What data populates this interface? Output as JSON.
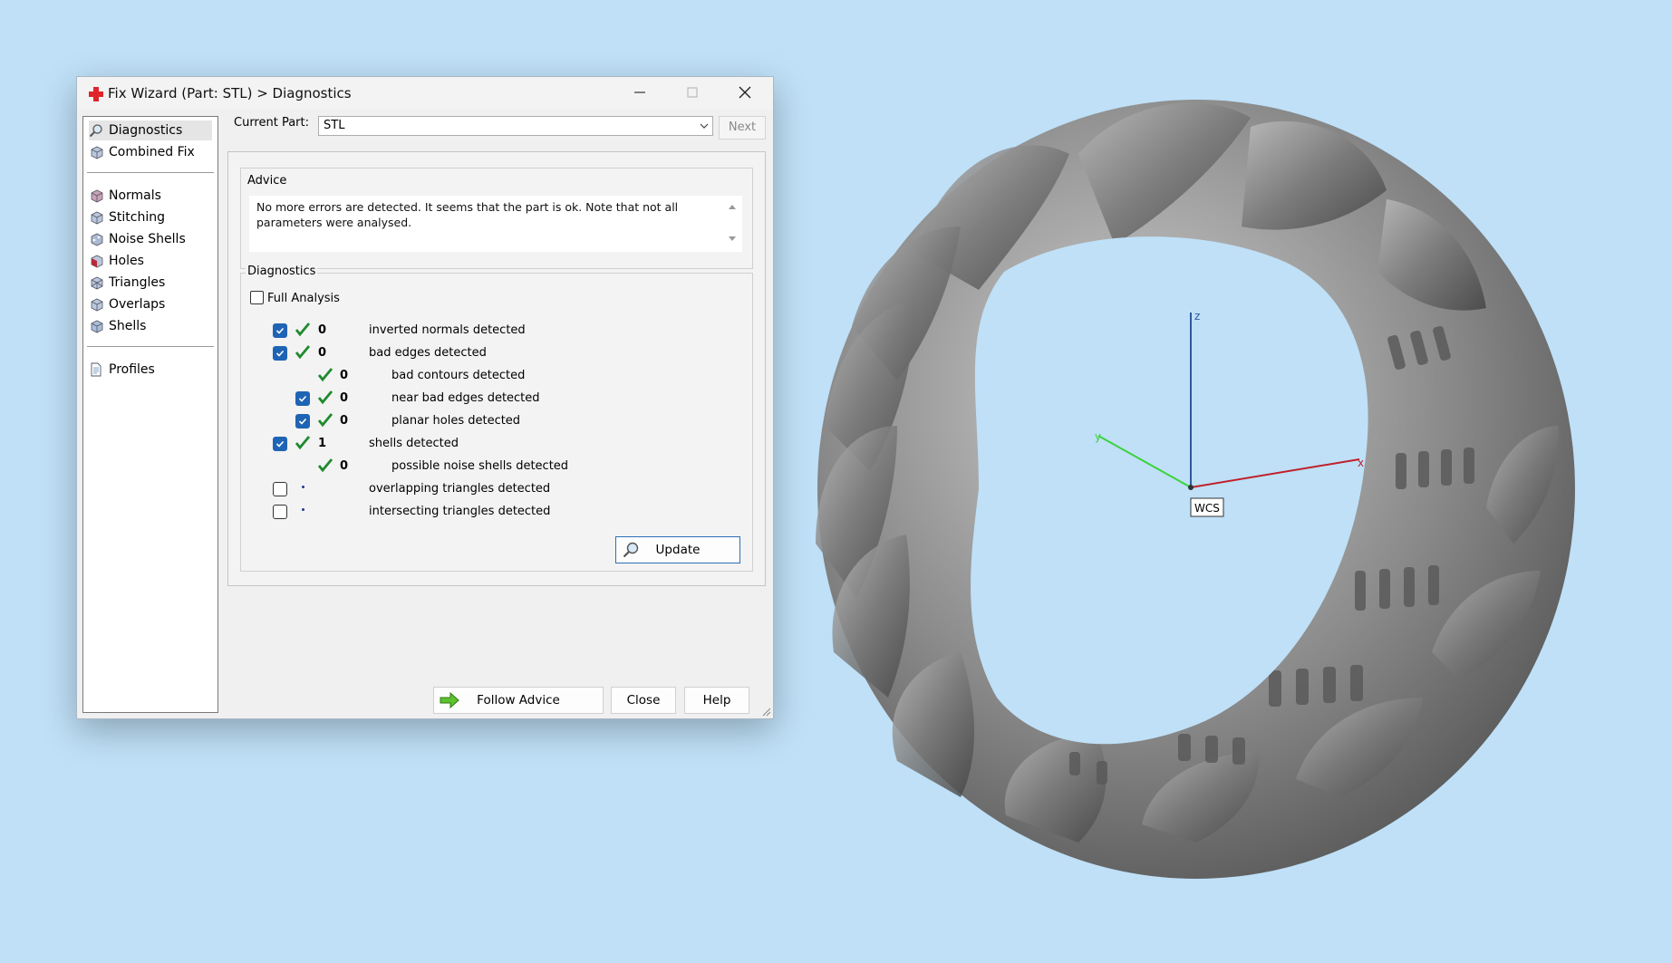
{
  "window": {
    "title": "Fix Wizard (Part: STL) > Diagnostics",
    "minimize_glyph": "–",
    "maximize_glyph": "□",
    "close_glyph": "✕"
  },
  "nav": {
    "items": [
      {
        "label": "Diagnostics",
        "icon": "magnifier-icon",
        "selected": true
      },
      {
        "label": "Combined Fix",
        "icon": "cube-icon"
      },
      {
        "label": "Normals",
        "icon": "cube-icon"
      },
      {
        "label": "Stitching",
        "icon": "cube-icon"
      },
      {
        "label": "Noise Shells",
        "icon": "cube-icon"
      },
      {
        "label": "Holes",
        "icon": "cube-icon"
      },
      {
        "label": "Triangles",
        "icon": "cube-icon"
      },
      {
        "label": "Overlaps",
        "icon": "cube-icon"
      },
      {
        "label": "Shells",
        "icon": "cube-icon"
      },
      {
        "label": "Profiles",
        "icon": "document-icon"
      }
    ]
  },
  "current_part": {
    "label": "Current Part:",
    "value": "STL"
  },
  "next_button": "Next",
  "advice": {
    "title": "Advice",
    "text": "No more errors are detected. It seems that the part is ok. Note that not all parameters were analysed."
  },
  "diagnostics": {
    "title": "Diagnostics",
    "full_analysis_label": "Full Analysis",
    "full_analysis_checked": false,
    "rows": [
      {
        "checked": true,
        "ok": true,
        "count": "0",
        "label": "inverted normals detected",
        "indent": 0
      },
      {
        "checked": true,
        "ok": true,
        "count": "0",
        "label": "bad edges detected",
        "indent": 0
      },
      {
        "checked": null,
        "ok": true,
        "count": "0",
        "label": "bad contours detected",
        "indent": 1
      },
      {
        "checked": true,
        "ok": true,
        "count": "0",
        "label": "near bad edges detected",
        "indent": 1
      },
      {
        "checked": true,
        "ok": true,
        "count": "0",
        "label": "planar holes detected",
        "indent": 1
      },
      {
        "checked": true,
        "ok": true,
        "count": "1",
        "label": "shells detected",
        "indent": 0
      },
      {
        "checked": null,
        "ok": true,
        "count": "0",
        "label": "possible noise shells detected",
        "indent": 1
      },
      {
        "checked": false,
        "ok": false,
        "count": "",
        "label": "overlapping triangles detected",
        "indent": 0
      },
      {
        "checked": false,
        "ok": false,
        "count": "",
        "label": "intersecting triangles detected",
        "indent": 0
      }
    ],
    "update_button": "Update"
  },
  "buttons": {
    "follow_advice": "Follow Advice",
    "close": "Close",
    "help": "Help"
  },
  "viewport": {
    "axis_x": "x",
    "axis_y": "y",
    "axis_z": "z",
    "wcs_label": "WCS",
    "colors": {
      "background": "#bfe0f7",
      "x_axis": "#c0202a",
      "y_axis": "#3cd23c",
      "z_axis": "#2c5a9c",
      "model": "#7d7d7d"
    }
  }
}
